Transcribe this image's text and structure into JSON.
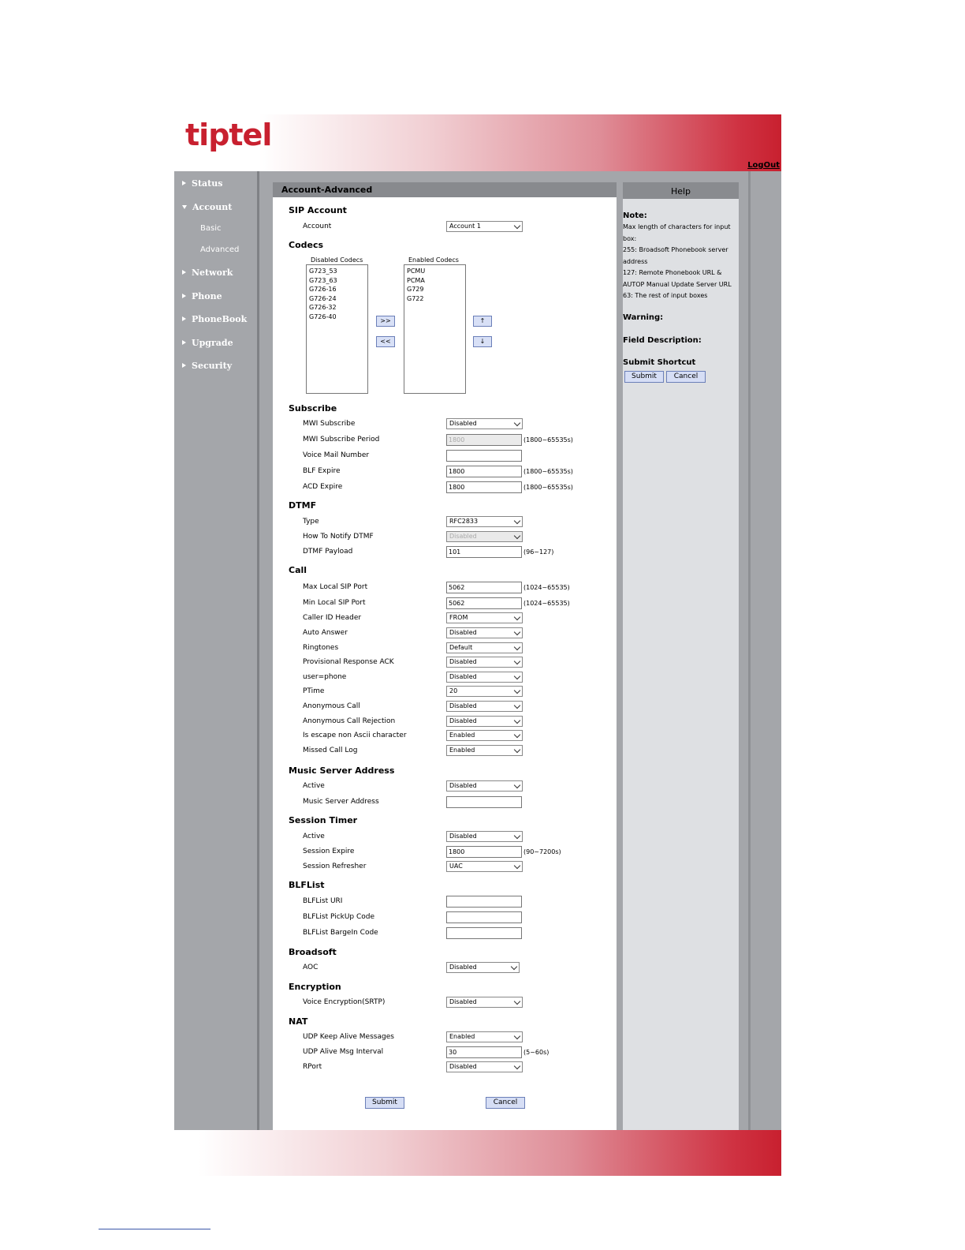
{
  "brand": {
    "logo": "tiptel",
    "logout": "LogOut"
  },
  "sidebar": {
    "items": [
      {
        "label": "Status"
      },
      {
        "label": "Account"
      },
      {
        "label": "Network"
      },
      {
        "label": "Phone"
      },
      {
        "label": "PhoneBook"
      },
      {
        "label": "Upgrade"
      },
      {
        "label": "Security"
      }
    ],
    "account_sub": [
      "Basic",
      "Advanced"
    ]
  },
  "content": {
    "title": "Account-Advanced",
    "sip_account": {
      "heading": "SIP Account",
      "account_label": "Account",
      "account_value": "Account 1"
    },
    "codecs": {
      "heading": "Codecs",
      "disabled_caption": "Disabled Codecs",
      "enabled_caption": "Enabled Codecs",
      "disabled": [
        "G723_53",
        "G723_63",
        "G726-16",
        "G726-24",
        "G726-32",
        "G726-40"
      ],
      "enabled": [
        "PCMU",
        "PCMA",
        "G729",
        "G722"
      ],
      "add": ">>",
      "remove": "<<",
      "up": "↑",
      "down": "↓"
    },
    "subscribe": {
      "heading": "Subscribe",
      "mwi_subscribe": {
        "label": "MWI Subscribe",
        "value": "Disabled"
      },
      "mwi_period": {
        "label": "MWI Subscribe Period",
        "value": "1800",
        "range": "(1800~65535s)"
      },
      "voice_mail": {
        "label": "Voice Mail Number",
        "value": ""
      },
      "blf_expire": {
        "label": "BLF Expire",
        "value": "1800",
        "range": "(1800~65535s)"
      },
      "acd_expire": {
        "label": "ACD Expire",
        "value": "1800",
        "range": "(1800~65535s)"
      }
    },
    "dtmf": {
      "heading": "DTMF",
      "type": {
        "label": "Type",
        "value": "RFC2833"
      },
      "notify": {
        "label": "How To Notify DTMF",
        "value": "Disabled"
      },
      "payload": {
        "label": "DTMF Payload",
        "value": "101",
        "range": "(96~127)"
      }
    },
    "call": {
      "heading": "Call",
      "max_port": {
        "label": "Max Local SIP Port",
        "value": "5062",
        "range": "(1024~65535)"
      },
      "min_port": {
        "label": "Min Local SIP Port",
        "value": "5062",
        "range": "(1024~65535)"
      },
      "caller_id": {
        "label": "Caller ID Header",
        "value": "FROM"
      },
      "auto_answer": {
        "label": "Auto Answer",
        "value": "Disabled"
      },
      "ringtones": {
        "label": "Ringtones",
        "value": "Default"
      },
      "prov_ack": {
        "label": "Provisional Response ACK",
        "value": "Disabled"
      },
      "user_phone": {
        "label": "user=phone",
        "value": "Disabled"
      },
      "ptime": {
        "label": "PTime",
        "value": "20"
      },
      "anon_call": {
        "label": "Anonymous Call",
        "value": "Disabled"
      },
      "anon_reject": {
        "label": "Anonymous Call Rejection",
        "value": "Disabled"
      },
      "escape": {
        "label": "Is escape non Ascii character",
        "value": "Enabled"
      },
      "missed_log": {
        "label": "Missed Call Log",
        "value": "Enabled"
      }
    },
    "music": {
      "heading": "Music Server Address",
      "active": {
        "label": "Active",
        "value": "Disabled"
      },
      "address": {
        "label": "Music Server Address",
        "value": ""
      }
    },
    "session": {
      "heading": "Session Timer",
      "active": {
        "label": "Active",
        "value": "Disabled"
      },
      "expire": {
        "label": "Session Expire",
        "value": "1800",
        "range": "(90~7200s)"
      },
      "refresher": {
        "label": "Session Refresher",
        "value": "UAC"
      }
    },
    "blflist": {
      "heading": "BLFList",
      "uri": {
        "label": "BLFList URI",
        "value": ""
      },
      "pickup": {
        "label": "BLFList PickUp Code",
        "value": ""
      },
      "bargein": {
        "label": "BLFList BargeIn Code",
        "value": ""
      }
    },
    "broadsoft": {
      "heading": "Broadsoft",
      "aoc": {
        "label": "AOC",
        "value": "Disabled"
      }
    },
    "encryption": {
      "heading": "Encryption",
      "srtp": {
        "label": "Voice Encryption(SRTP)",
        "value": "Disabled"
      }
    },
    "nat": {
      "heading": "NAT",
      "keepalive": {
        "label": "UDP Keep Alive Messages",
        "value": "Enabled"
      },
      "interval": {
        "label": "UDP Alive Msg Interval",
        "value": "30",
        "range": "(5~60s)"
      },
      "rport": {
        "label": "RPort",
        "value": "Disabled"
      }
    },
    "submit": "Submit",
    "cancel": "Cancel"
  },
  "help": {
    "title": "Help",
    "note_heading": "Note:",
    "note_lines": [
      "Max length of characters for input",
      "box:",
      "255: Broadsoft Phonebook server",
      "address",
      "127: Remote Phonebook URL &",
      "AUTOP Manual Update Server URL",
      "63: The rest of input boxes"
    ],
    "warning_heading": "Warning:",
    "field_heading": "Field Description:",
    "shortcut_heading": "Submit Shortcut",
    "submit": "Submit",
    "cancel": "Cancel"
  },
  "colors": {
    "brand_red": "#c8202f",
    "sidebar_gray": "#a4a6aa",
    "title_gray": "#888a8e",
    "button_blue": "#d6def5"
  }
}
